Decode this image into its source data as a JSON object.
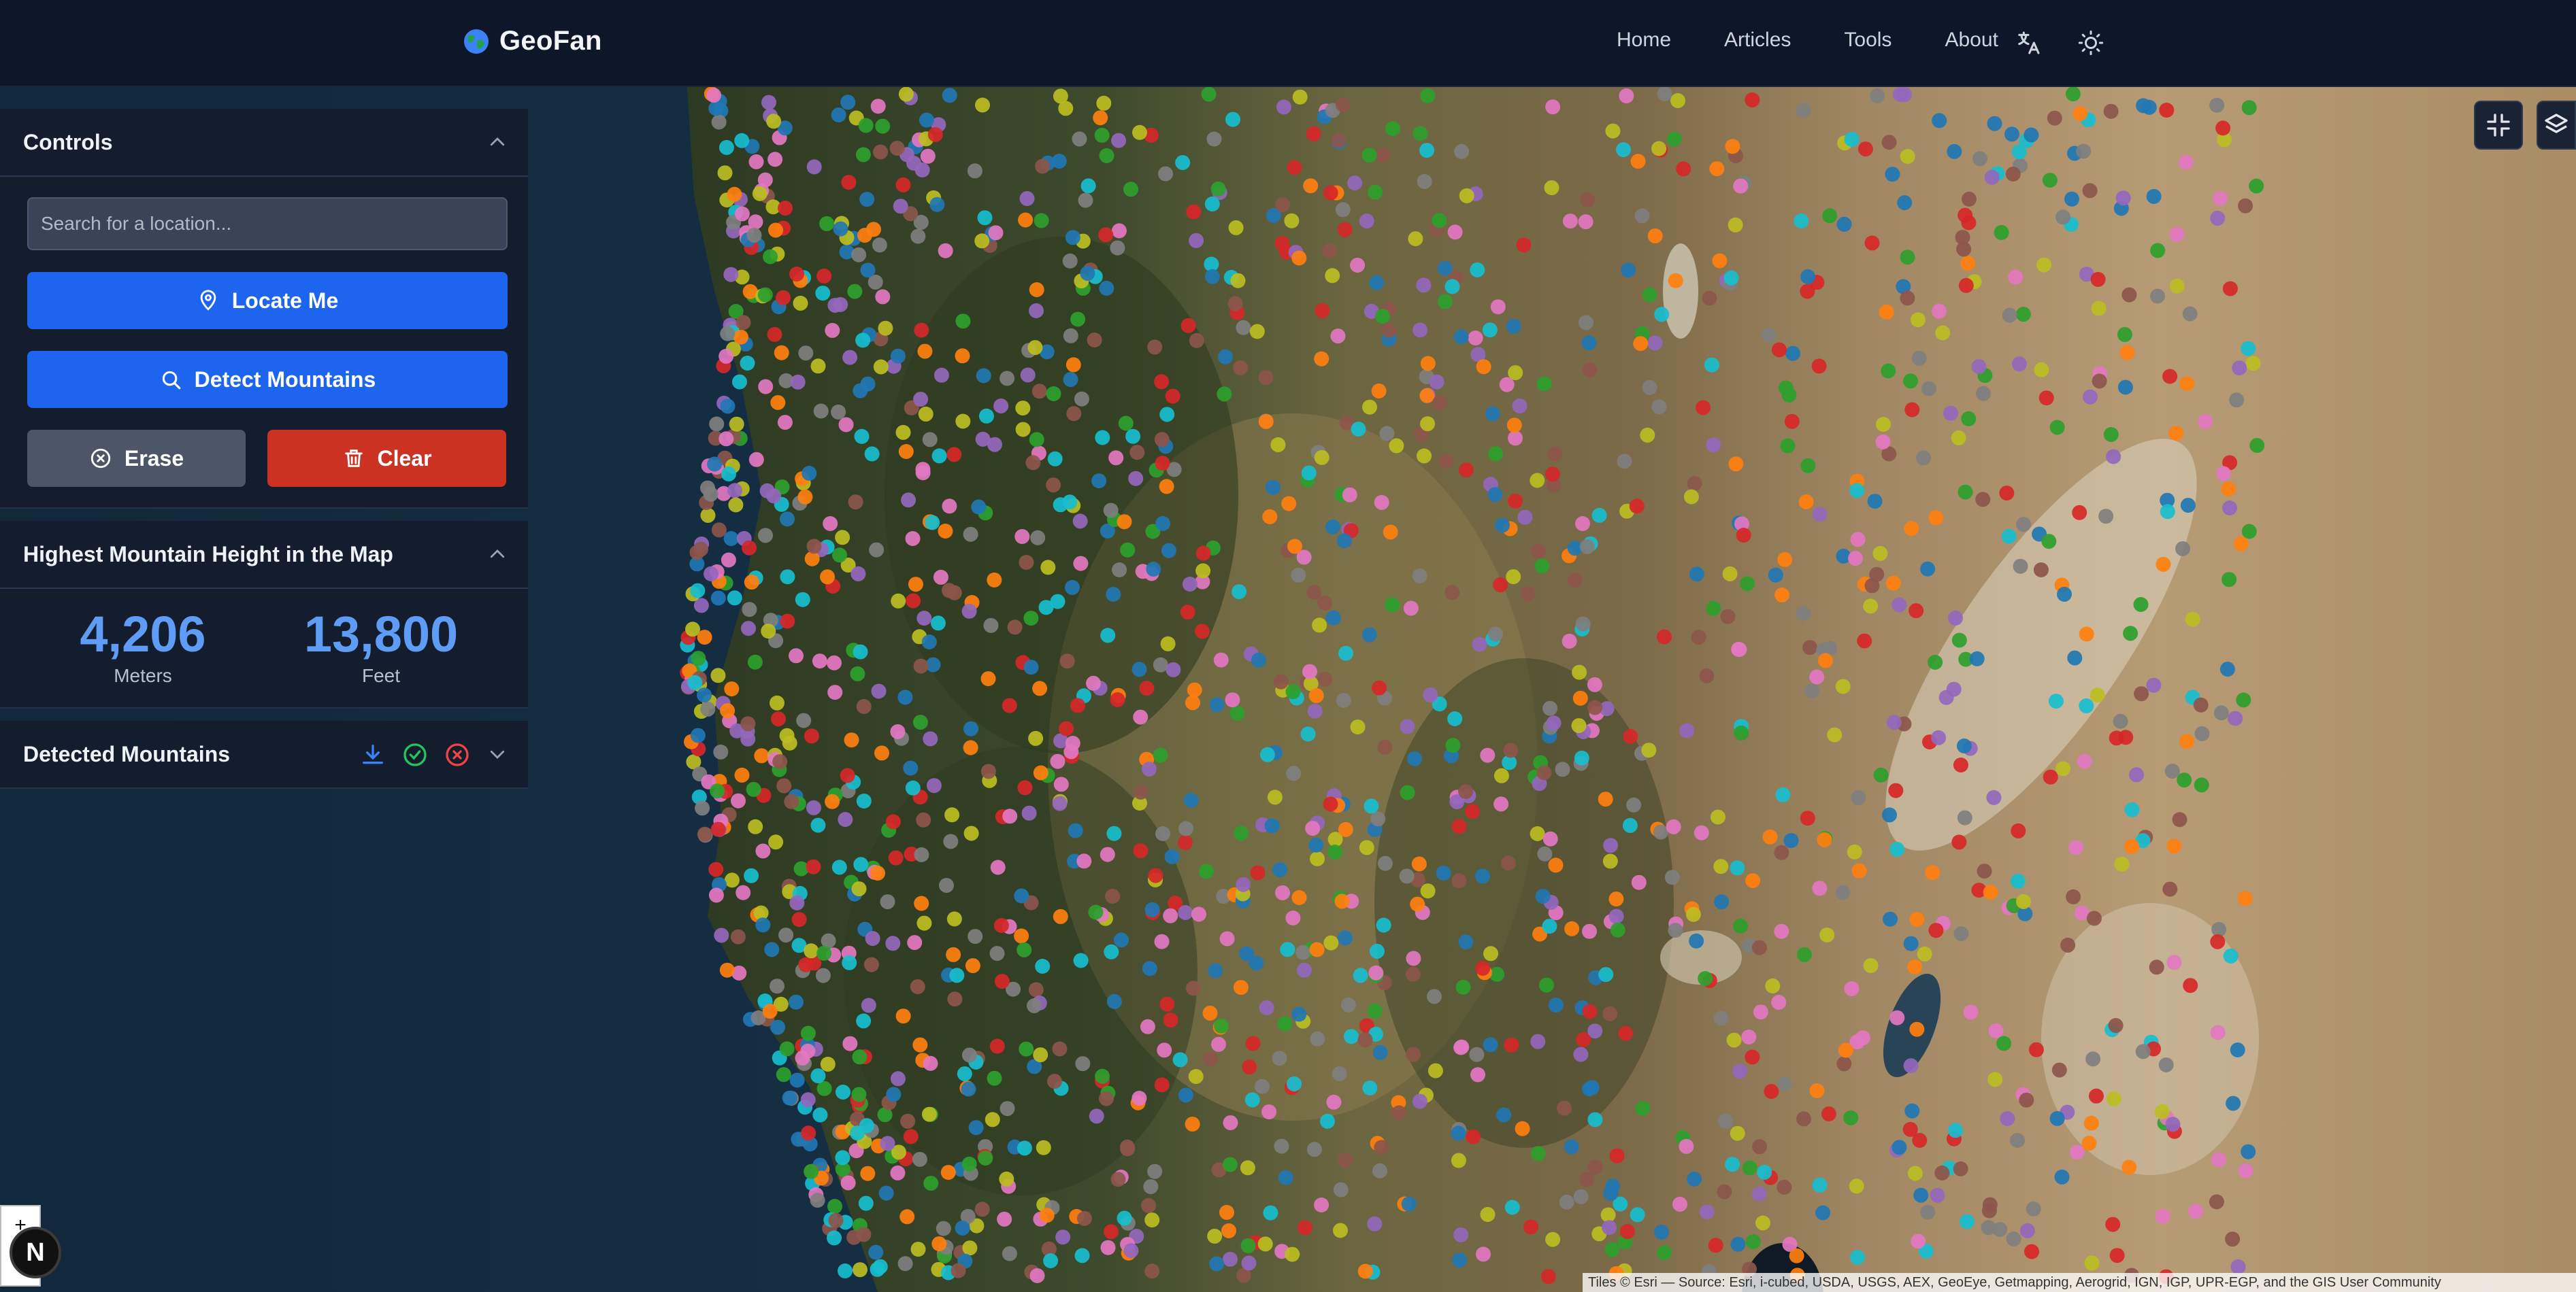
{
  "navbar": {
    "brand": "GeoFan",
    "links": [
      "Home",
      "Articles",
      "Tools",
      "About"
    ],
    "icons": [
      "globe-icon",
      "translate-icon",
      "sun-icon"
    ]
  },
  "controls": {
    "title": "Controls",
    "search_placeholder": "Search for a location...",
    "locate_label": "Locate Me",
    "detect_label": "Detect Mountains",
    "erase_label": "Erase",
    "clear_label": "Clear"
  },
  "highest": {
    "title": "Highest Mountain Height in the Map",
    "meters_value": "4,206",
    "meters_label": "Meters",
    "feet_value": "13,800",
    "feet_label": "Feet"
  },
  "detected": {
    "title": "Detected Mountains",
    "icons": [
      "download-icon",
      "check-circle-icon",
      "x-circle-icon",
      "chevron-down-icon"
    ]
  },
  "map": {
    "attribution": "Tiles © Esri — Source: Esri, i-cubed, USDA, USGS, AEX, GeoEye, Getmapping, Aerogrid, IGN, IGP, UPR-EGP, and the GIS User Community",
    "compass_label": "N",
    "zoom_in_label": "+",
    "marker_colors": [
      "#e377c2",
      "#17becf",
      "#2ca02c",
      "#ff7f0e",
      "#bcbd22",
      "#9467bd",
      "#1f77b4",
      "#8c564b",
      "#7f7f7f",
      "#d62728"
    ],
    "controls": [
      "fullscreen-exit-icon",
      "layers-icon"
    ]
  },
  "colors": {
    "accent": "#1d64ee",
    "danger": "#cc3222",
    "stat": "#5f9cf6"
  }
}
